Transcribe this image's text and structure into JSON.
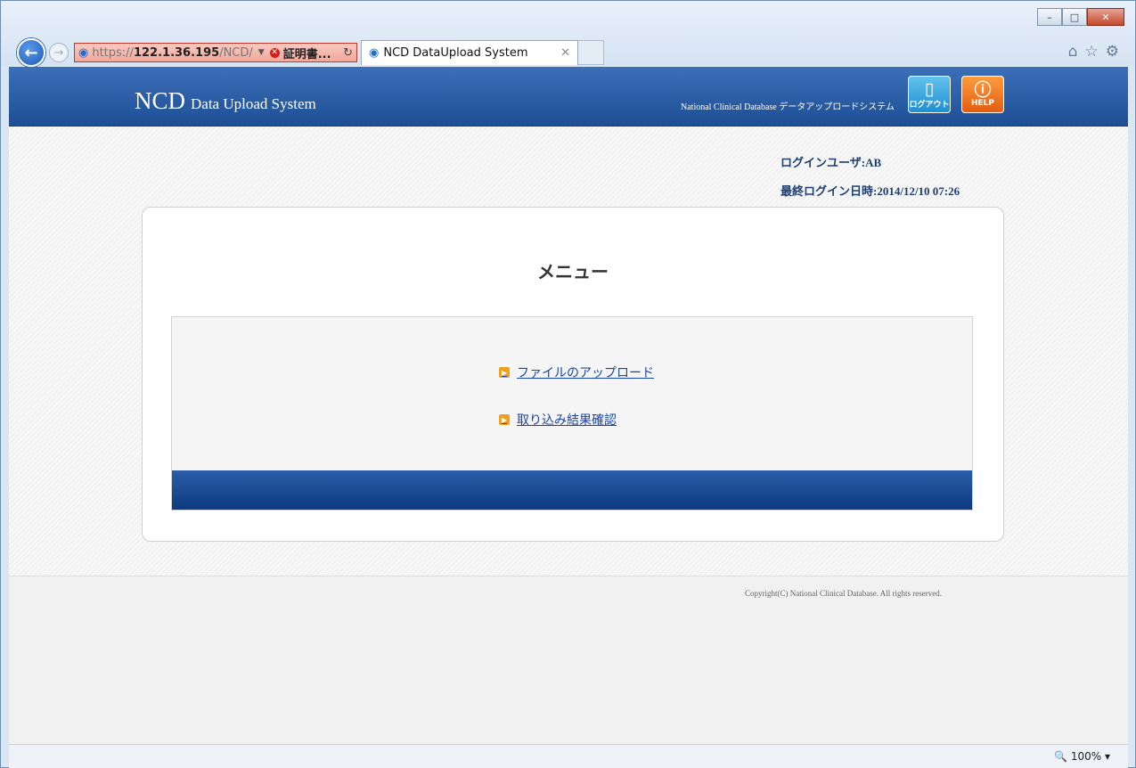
{
  "browser": {
    "address": {
      "scheme": "https://",
      "host": "122.1.36.195",
      "path": "/NCD/",
      "cert_label": "証明書..."
    },
    "tab_title": "NCD DataUpload System",
    "zoom": "100%"
  },
  "header": {
    "logo_main": "NCD",
    "logo_sub": "Data Upload System",
    "tagline": "National Clinical Database データアップロードシステム",
    "logout_label": "ログアウト",
    "help_label": "HELP"
  },
  "session": {
    "login_user": "ログインユーザ:AB",
    "last_login": "最終ログイン日時:2014/12/10 07:26"
  },
  "menu": {
    "title": "メニュー",
    "items": [
      {
        "label": "ファイルのアップロード"
      },
      {
        "label": "取り込み結果確認"
      }
    ]
  },
  "footer": {
    "copyright": "Copyright(C) National Clinical Database. All rights reserved."
  },
  "colors": {
    "header_blue": "#2a5ea8",
    "link": "#1a45a8",
    "bullet": "#f0a020",
    "help_orange": "#e45d10"
  }
}
